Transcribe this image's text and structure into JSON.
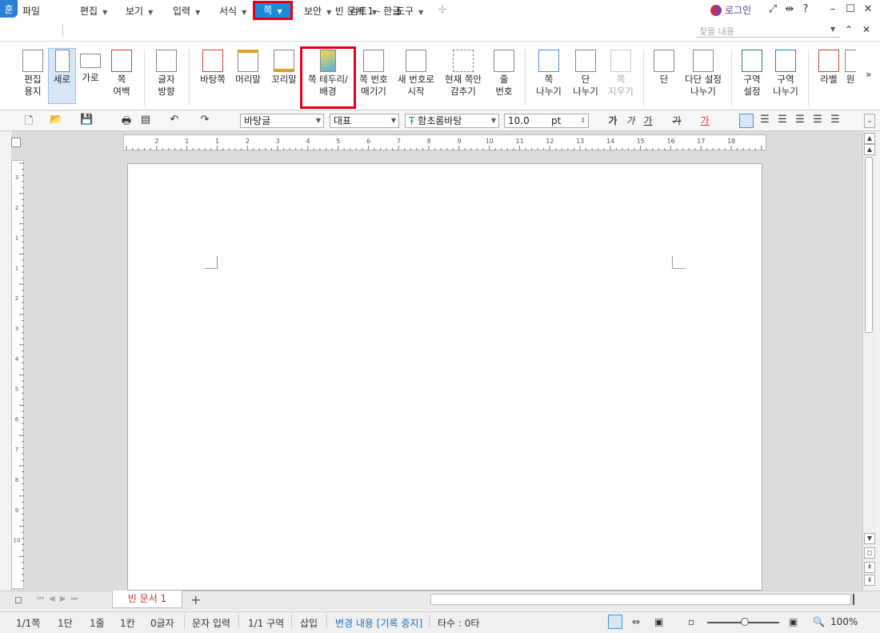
{
  "window": {
    "title": "빈 문서 1 - 한글",
    "logo": "훈",
    "login": "로그인",
    "controls": [
      "fullscreen-icon",
      "split-icon",
      "help-icon",
      "minimize-icon",
      "maximize-icon",
      "close-icon"
    ],
    "help": "?"
  },
  "menu": {
    "file": "파일",
    "edit": "편집",
    "view": "보기",
    "insert": "입력",
    "format": "서식",
    "page": "쪽",
    "security": "보안",
    "review": "검토",
    "tools": "도구",
    "search_placeholder": "찾을 내용"
  },
  "ribbon": {
    "edit_paper": "편집\n용지",
    "portrait": "세로",
    "landscape": "가로",
    "page_margin": "쪽\n여백",
    "text_direction": "글자\n방향",
    "background_page": "바탕쪽",
    "header": "머리말",
    "footer": "꼬리말",
    "page_border_bg": "쪽 테두리/\n배경",
    "page_number": "쪽 번호\n매기기",
    "new_number_start": "새 번호로\n시작",
    "hide_current_page": "현재 쪽만\n감추기",
    "line_number": "줄\n번호",
    "page_break": "쪽\n나누기",
    "column_break": "단\n나누기",
    "page_delete": "쪽\n지우기",
    "column": "단",
    "multi_column": "다단 설정\n나누기",
    "section_setting": "구역\n설정",
    "section_break": "구역\n나누기",
    "label": "라벨",
    "manuscript": "원",
    "more": "»"
  },
  "format_toolbar": {
    "style": "바탕글",
    "language": "대표",
    "font": "함초롬바탕",
    "font_size": "10.0",
    "unit": "pt",
    "bold_sample": "가",
    "italic_sample": "가",
    "underline_sample": "가",
    "strike_sample": "가",
    "color_sample": "가"
  },
  "ruler": {
    "h_marks": [
      "2",
      "1",
      "1",
      "2",
      "3",
      "4",
      "5",
      "6",
      "7",
      "8",
      "9",
      "10",
      "11",
      "12",
      "13",
      "14",
      "15",
      "16",
      "17",
      "18"
    ],
    "v_marks": [
      "3",
      "2",
      "1",
      "1",
      "2",
      "3",
      "4",
      "5",
      "6",
      "7",
      "8",
      "9",
      "10"
    ]
  },
  "tabs": {
    "doc_tab": "빈 문서 1",
    "add": "+"
  },
  "status": {
    "page": "1/1쪽",
    "column": "1단",
    "line": "1줄",
    "cell": "1칸",
    "chars": "0글자",
    "input_mode": "문자 입력",
    "section": "1/1 구역",
    "insert": "삽입",
    "track_changes": "변경 내용 [기록 중지]",
    "typing": "타수 : 0타",
    "zoom": "100%"
  }
}
